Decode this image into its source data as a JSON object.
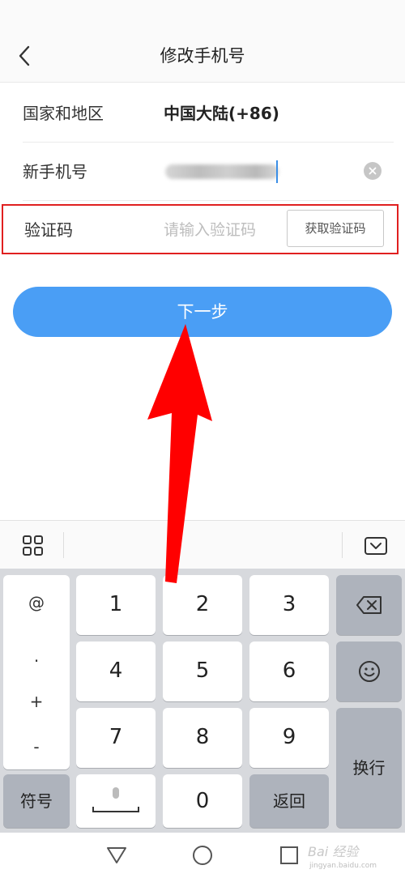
{
  "header": {
    "title": "修改手机号"
  },
  "form": {
    "region": {
      "label": "国家和地区",
      "value": "中国大陆(+86)"
    },
    "phone": {
      "label": "新手机号"
    },
    "code": {
      "label": "验证码",
      "placeholder": "请输入验证码",
      "button_label": "获取验证码"
    }
  },
  "next_button": {
    "label": "下一步"
  },
  "keyboard": {
    "symbols": [
      "@",
      ".",
      "+",
      "-"
    ],
    "digits": [
      "1",
      "2",
      "3",
      "4",
      "5",
      "6",
      "7",
      "8",
      "9",
      "0"
    ],
    "symbol_key_label": "符号",
    "return_key_label": "返回",
    "enter_key_label": "换行"
  },
  "watermark": {
    "text": "Bai 经验",
    "subtext": "jingyan.baidu.com"
  },
  "colors": {
    "accent": "#4a9ef5",
    "highlight_border": "#e02020",
    "arrow": "#ff0000"
  }
}
